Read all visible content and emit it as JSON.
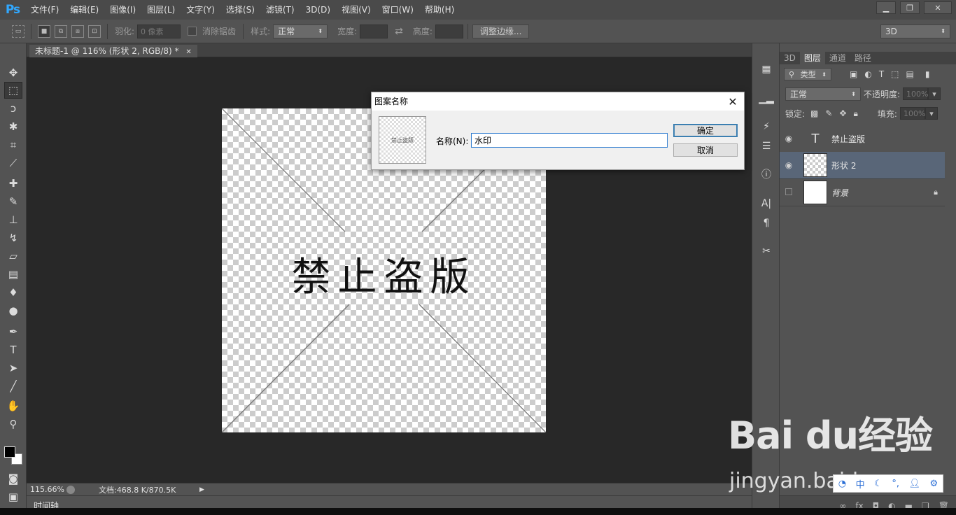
{
  "app": {
    "logo": "Ps",
    "menu": [
      "文件(F)",
      "编辑(E)",
      "图像(I)",
      "图层(L)",
      "文字(Y)",
      "选择(S)",
      "滤镜(T)",
      "3D(D)",
      "视图(V)",
      "窗口(W)",
      "帮助(H)"
    ],
    "window_controls": [
      "minimize-icon",
      "restore-icon",
      "close-icon"
    ]
  },
  "options": {
    "feather_label": "羽化:",
    "feather_value": "0 像素",
    "antialias_label": "消除锯齿",
    "style_label": "样式:",
    "style_value": "正常",
    "width_label": "宽度:",
    "height_label": "高度:",
    "refine_edge": "调整边缘...",
    "workspace": "3D"
  },
  "document": {
    "tab_title": "未标题-1 @ 116% (形状 2, RGB/8) *",
    "canvas_text": "禁止盗版",
    "zoom": "115.66%",
    "doc_size": "文档:468.8 K/870.5K",
    "timeline": "时间轴"
  },
  "tools": [
    "move-tool",
    "marquee-tool",
    "lasso-tool",
    "magic-wand-tool",
    "crop-tool",
    "eyedropper-tool",
    "healing-tool",
    "brush-tool",
    "stamp-tool",
    "history-brush-tool",
    "eraser-tool",
    "gradient-tool",
    "blur-tool",
    "dodge-tool",
    "pen-tool",
    "type-tool",
    "path-select-tool",
    "line-tool",
    "hand-tool",
    "zoom-tool"
  ],
  "layers_panel": {
    "tabs": [
      "3D",
      "图层",
      "通道",
      "路径"
    ],
    "active_tab": "图层",
    "filter_kind": "类型",
    "blend_mode": "正常",
    "opacity_label": "不透明度:",
    "opacity_value": "100%",
    "lock_label": "锁定:",
    "fill_label": "填充:",
    "fill_value": "100%",
    "layers": [
      {
        "name": "禁止盗版",
        "kind": "type",
        "visible": true,
        "selected": false
      },
      {
        "name": "形状 2",
        "kind": "shape",
        "visible": true,
        "selected": true
      },
      {
        "name": "背景",
        "kind": "background",
        "visible": false,
        "selected": false,
        "locked": true
      }
    ]
  },
  "dialog": {
    "title": "图案名称",
    "name_label": "名称(N):",
    "name_value": "水印",
    "preview_text": "禁止盗版",
    "ok": "确定",
    "cancel": "取消"
  },
  "watermark": {
    "main": "Bai du经验",
    "sub": "jingyan.baidu",
    "ime": [
      "中"
    ]
  },
  "colors": {
    "accent": "#31a8ff",
    "panel_bg": "#535353",
    "canvas_bg": "#282828",
    "selection": "#596678"
  }
}
